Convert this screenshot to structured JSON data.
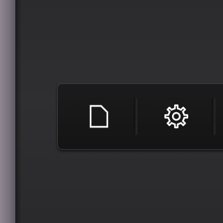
{
  "toolbar": {
    "items": [
      {
        "icon": "document-icon",
        "color": "#ffffff"
      },
      {
        "icon": "gear-icon",
        "color": "#ffffff"
      }
    ]
  },
  "colors": {
    "background": "#2d2d2f",
    "toolbar": "#161617",
    "bezel": "#837c88",
    "icon": "#ffffff"
  }
}
